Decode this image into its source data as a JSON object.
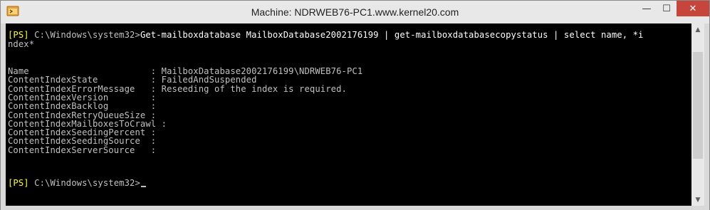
{
  "window": {
    "title": "Machine: NDRWEB76-PC1.www.kernel20.com",
    "buttons": {
      "minimize": "—",
      "maximize": "☐",
      "close": "✕"
    },
    "icon": "powershell-app-icon"
  },
  "console": {
    "cmd1": {
      "prompt": "[PS]",
      "path": " C:\\Windows\\system32>",
      "command": "Get-mailboxdatabase MailboxDatabase2002176199 | get-mailboxdatabasecopystatus | select name, *i"
    },
    "wrap": "ndex*",
    "props": [
      "Name                       : MailboxDatabase2002176199\\NDRWEB76-PC1",
      "ContentIndexState          : FailedAndSuspended",
      "ContentIndexErrorMessage   : Reseeding of the index is required.",
      "ContentIndexVersion        :",
      "ContentIndexBacklog        :",
      "ContentIndexRetryQueueSize :",
      "ContentIndexMailboxesToCrawl :",
      "ContentIndexSeedingPercent :",
      "ContentIndexSeedingSource  :",
      "ContentIndexServerSource   :"
    ],
    "cmd2": {
      "prompt": "[PS]",
      "path": " C:\\Windows\\system32>"
    }
  }
}
